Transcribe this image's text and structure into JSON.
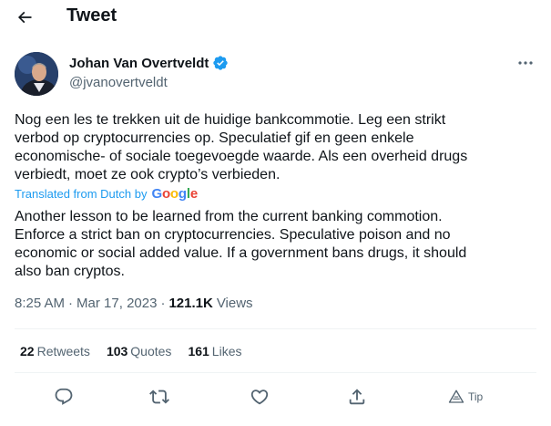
{
  "header": {
    "title": "Tweet"
  },
  "author": {
    "name": "Johan Van Overtveldt",
    "handle": "@jvanovertveldt"
  },
  "tweet": {
    "text": "Nog een les te trekken uit de huidige bankcommotie. Leg een strikt\nverbod op cryptocurrencies op. Speculatief gif en geen enkele\neconomische- of sociale toegevoegde waarde. Als een overheid drugs\nverbiedt, moet ze ook crypto’s verbieden.",
    "translated_label": "Translated from Dutch by",
    "translator": "Google",
    "translation": "Another lesson to be learned from the current banking commotion.\nEnforce a strict ban on cryptocurrencies. Speculative poison and no\neconomic or social added value. If a government bans drugs, it should\nalso ban cryptos.",
    "time": "8:25 AM",
    "separator": "·",
    "date": "Mar 17, 2023",
    "views_count": "121.1K",
    "views_label": "Views"
  },
  "stats": {
    "retweets_count": "22",
    "retweets_label": "Retweets",
    "quotes_count": "103",
    "quotes_label": "Quotes",
    "likes_count": "161",
    "likes_label": "Likes"
  },
  "actions": {
    "tip_label": "Tip"
  },
  "colors": {
    "accent": "#1d9bf0",
    "text": "#0f1419",
    "secondary": "#536471",
    "divider": "#eff3f4"
  }
}
